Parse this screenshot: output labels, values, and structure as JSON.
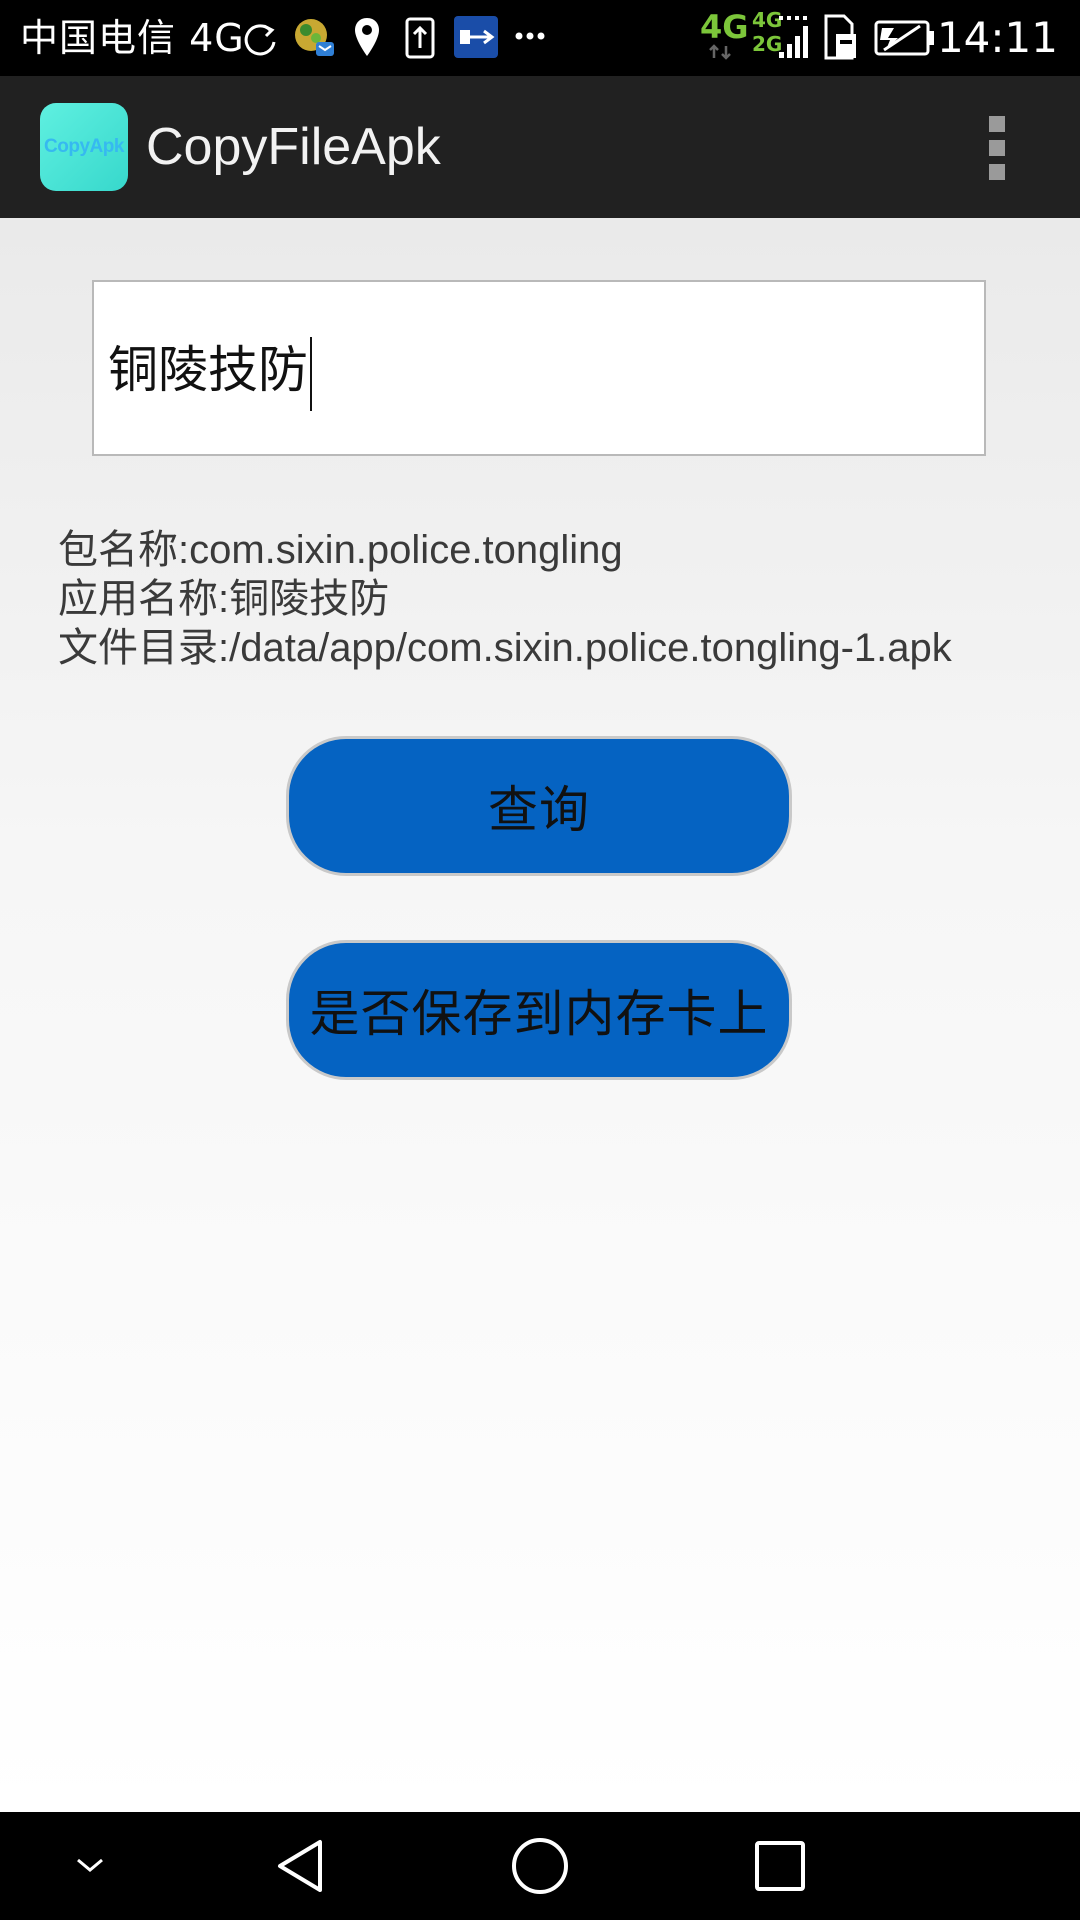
{
  "status_bar": {
    "carrier": "中国电信 4G",
    "network_primary": "4G",
    "network_secondary_top": "4G",
    "network_secondary_bottom": "2G",
    "clock": "14:11",
    "icons": [
      "sync-icon",
      "app-notification-icon",
      "location-icon",
      "upload-icon",
      "usb-icon",
      "more-dots-icon",
      "signal-icon",
      "sim-icon",
      "battery-icon"
    ]
  },
  "action_bar": {
    "app_icon_text": "CopyApk",
    "title": "CopyFileApk"
  },
  "search": {
    "value": "铜陵技防"
  },
  "info": {
    "package_line": "包名称:com.sixin.police.tongling",
    "app_name_line": "应用名称:铜陵技防",
    "file_dir_line": "文件目录:/data/app/com.sixin.police.tongling-1.apk"
  },
  "buttons": {
    "query": "查询",
    "save": "是否保存到内存卡上"
  },
  "colors": {
    "button_blue": "#0563c2",
    "action_bar": "#212121",
    "network_green": "#7cc63a",
    "app_icon": "#37d8cc"
  }
}
